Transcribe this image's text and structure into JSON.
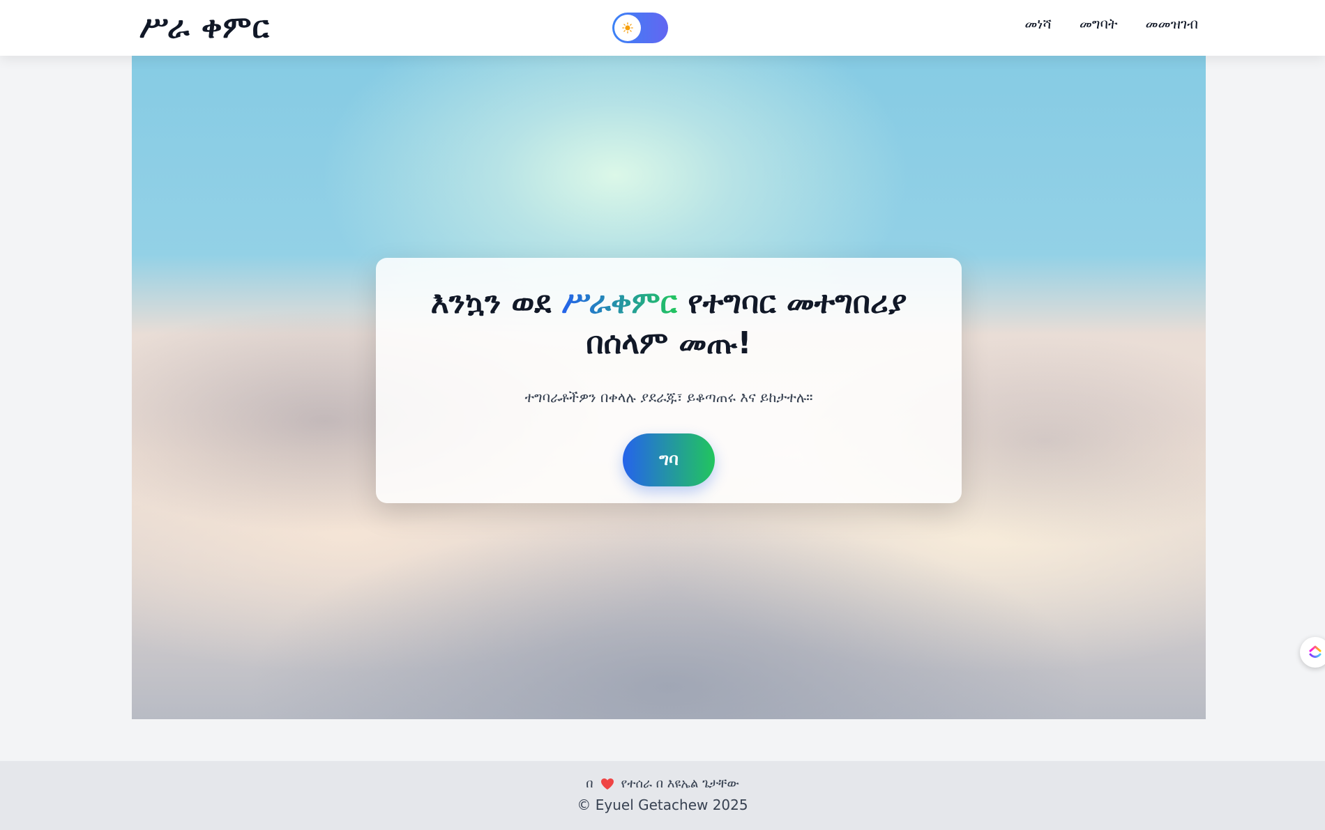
{
  "header": {
    "logo": "ሥራ ቀምር",
    "theme_toggle": {
      "icon": "sun-icon",
      "state": "light"
    },
    "nav": [
      {
        "label": "መነሻ"
      },
      {
        "label": "መግባት"
      },
      {
        "label": "መመዝገብ"
      }
    ]
  },
  "hero": {
    "title_prefix": "እንኳን ወደ ",
    "title_brand": "ሥራቀምር",
    "title_suffix": " የተግባር መተግበሪያ በሰላም መጡ!",
    "subtitle": "ተግባራቶችዎን በቀላሉ ያደራጁ፣ ይቆጣጠሩ እና ይከታተሉ።",
    "cta_label": "ግባ"
  },
  "footer": {
    "made_with_prefix": "በ",
    "made_with_suffix": "የተሰራ በ እዩኤል ጌታቸው",
    "copyright": "© Eyuel Getachew 2025"
  },
  "colors": {
    "brand_gradient_start": "#2563eb",
    "brand_gradient_end": "#22c55e",
    "heart": "#ef4444"
  }
}
